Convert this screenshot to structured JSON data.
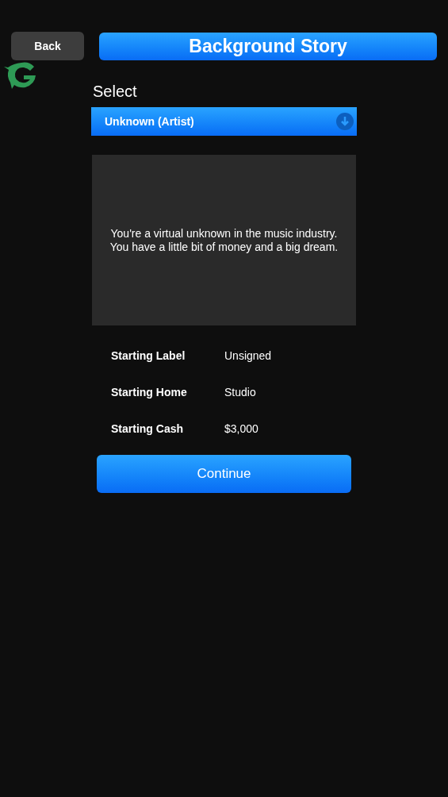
{
  "back_button": "Back",
  "title": "Background Story",
  "select": {
    "label": "Select",
    "value": "Unknown (Artist)"
  },
  "description": "You're a virtual unknown in the music industry. You have a little bit of money and a big dream.",
  "details": [
    {
      "label": "Starting Label",
      "value": "Unsigned"
    },
    {
      "label": "Starting Home",
      "value": "Studio"
    },
    {
      "label": "Starting Cash",
      "value": "$3,000"
    }
  ],
  "continue_button": "Continue"
}
